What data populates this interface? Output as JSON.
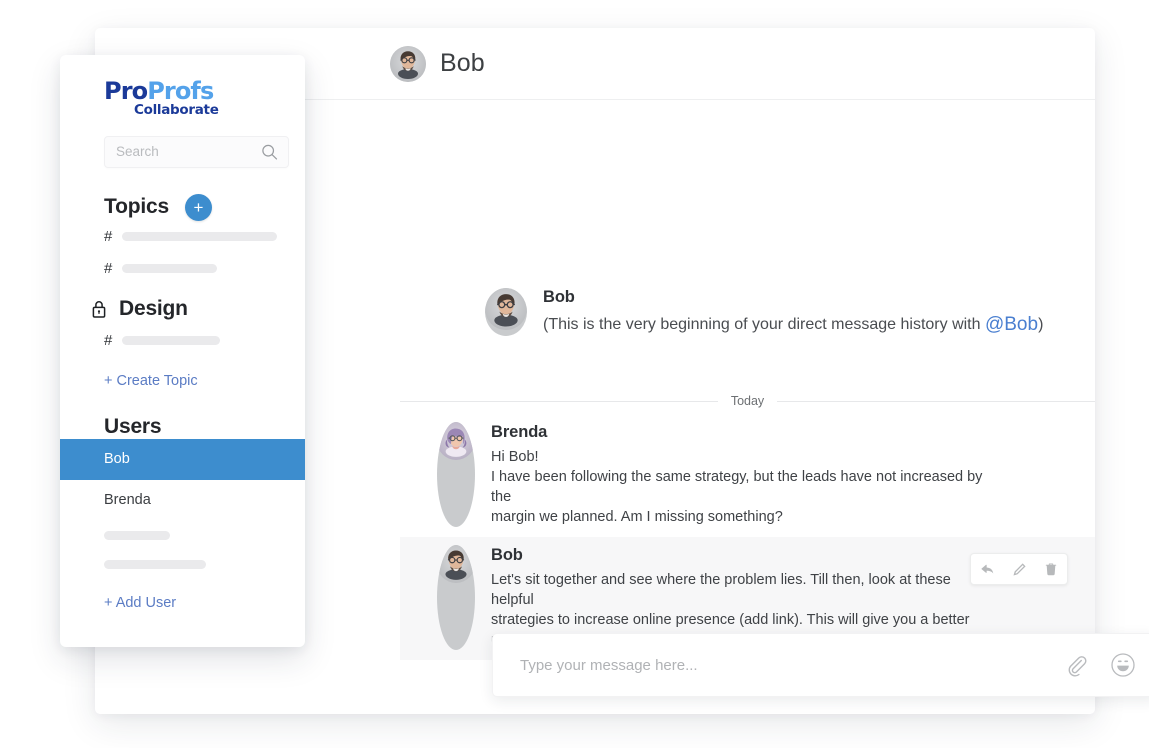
{
  "app": {
    "logo": {
      "part1": "Pro",
      "part2": "Profs",
      "subtitle": "Collaborate",
      "color_dark": "#1b3a99",
      "color_light": "#54a2ea"
    },
    "accent_color": "#3d8dce",
    "link_color": "#5b7cc4"
  },
  "sidebar": {
    "search": {
      "value": "",
      "placeholder": "Search"
    },
    "topics": {
      "title": "Topics",
      "add_label": "+",
      "items": [
        {
          "hash": "#",
          "label": "",
          "skeleton_width": 155
        },
        {
          "hash": "#",
          "label": "",
          "skeleton_width": 95
        }
      ],
      "group": {
        "title": "Design",
        "locked": true,
        "items": [
          {
            "hash": "#",
            "label": "",
            "skeleton_width": 98
          }
        ]
      },
      "create_label": "+ Create Topic"
    },
    "users": {
      "title": "Users",
      "items": [
        {
          "name": "Bob",
          "selected": true
        },
        {
          "name": "Brenda",
          "selected": false
        }
      ],
      "skeletons": [
        66,
        102
      ],
      "add_label": "+ Add User"
    }
  },
  "header": {
    "title": "Bob",
    "avatar_alt": "bob-avatar"
  },
  "conversation": {
    "intro": {
      "author": "Bob",
      "text_before": "(This is the very beginning of your direct message history with ",
      "mention": "@Bob",
      "text_after": ")"
    },
    "day_divider": "Today",
    "messages": [
      {
        "author": "Brenda",
        "avatar": "brenda-avatar",
        "lines": [
          "Hi Bob!",
          "I have been following the same strategy, but the leads have not increased by the",
          "margin we planned. Am I missing something?"
        ],
        "highlighted": false,
        "actions": []
      },
      {
        "author": "Bob",
        "avatar": "bob-avatar",
        "lines": [
          "Let's sit together and see where the problem lies. Till then, look at these helpful",
          "strategies to increase online presence (add link). This will give you a better",
          "understanding."
        ],
        "highlighted": true,
        "actions": [
          "reply",
          "edit",
          "delete"
        ]
      }
    ]
  },
  "composer": {
    "value": "",
    "placeholder": "Type your message here...",
    "attach_icon": "paperclip-icon",
    "emoji_icon": "smiley-icon"
  }
}
